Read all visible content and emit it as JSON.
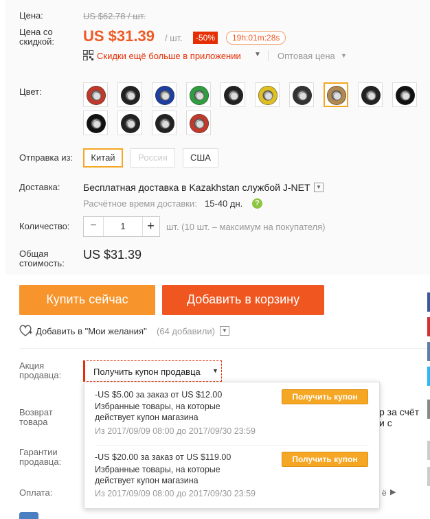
{
  "price": {
    "label": "Цена:",
    "old_price": "US $62.78 / шт.",
    "discount_label_1": "Цена со",
    "discount_label_2": "скидкой:",
    "new_price": "US $31.39",
    "unit": "/ шт.",
    "discount_badge": "-50%",
    "timer": "19h:01m:28s",
    "app_link": "Скидки ещё больше в приложении",
    "wholesale": "Оптовая цена"
  },
  "color": {
    "label": "Цвет:",
    "swatches": [
      {
        "color": "#c0392b"
      },
      {
        "color": "#222222"
      },
      {
        "color": "#1f3fa0"
      },
      {
        "color": "#2e9e3e"
      },
      {
        "color": "#222222"
      },
      {
        "color": "#e0c020"
      },
      {
        "color": "#333333"
      },
      {
        "color": "#b08850"
      },
      {
        "color": "#222222"
      },
      {
        "color": "#111111"
      },
      {
        "color": "#111111"
      },
      {
        "color": "#222222"
      },
      {
        "color": "#222222"
      },
      {
        "color": "#c0392b"
      }
    ]
  },
  "ship_from": {
    "label": "Отправка из:",
    "options": [
      "Китай",
      "Россия",
      "США"
    ]
  },
  "delivery": {
    "label": "Доставка:",
    "method": "Бесплатная доставка в Kazakhstan службой J-NET",
    "time_label": "Расчётное время доставки:",
    "time_value": "15-40 дн."
  },
  "quantity": {
    "label": "Количество:",
    "value": "1",
    "note": "шт. (10 шт. – максимум на покупателя)"
  },
  "total": {
    "label_1": "Общая",
    "label_2": "стоимость:",
    "value": "US $31.39"
  },
  "actions": {
    "buy_now": "Купить сейчас",
    "add_to_cart": "Добавить в корзину",
    "wishlist": "Добавить в \"Мои желания\"",
    "wishlist_count": "(64 добавили)"
  },
  "promo": {
    "label_1": "Акция",
    "label_2": "продавца:",
    "coupon_dropdown": "Получить купон продавца",
    "coupons": [
      {
        "title": "-US $5.00 за заказ от US $12.00",
        "desc_1": "Избранные товары, на которые",
        "desc_2": "действует купон магазина",
        "period": "Из 2017/09/09 08:00 до 2017/09/30 23:59",
        "button": "Получить купон"
      },
      {
        "title": "-US $20.00 за заказ от US $119.00",
        "desc_1": "Избранные товары, на которые",
        "desc_2": "действует купон магазина",
        "period": "Из 2017/09/09 08:00 до 2017/09/30 23:59",
        "button": "Получить купон"
      }
    ]
  },
  "returns": {
    "label_1": "Возврат",
    "label_2": "товара",
    "partial_1": "р за счёт",
    "partial_2": "и с"
  },
  "guarantee": {
    "label_1": "Гарантии",
    "label_2": "продавца:"
  },
  "payment": {
    "label": "Оплата:",
    "partial": "ё"
  },
  "colors": {
    "accent": "#f05a24",
    "button_orange": "#f7942b",
    "button_red": "#f0561f",
    "selected_border": "#f5a623"
  }
}
